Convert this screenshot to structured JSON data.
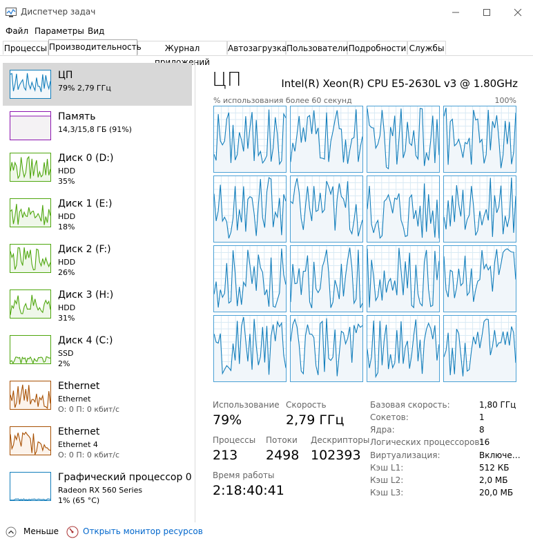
{
  "window": {
    "title": "Диспетчер задач"
  },
  "menu": [
    "Файл",
    "Параметры",
    "Вид"
  ],
  "tabs": [
    "Процессы",
    "Производительность",
    "Журнал приложений",
    "Автозагрузка",
    "Пользователи",
    "Подробности",
    "Службы"
  ],
  "active_tab": "Производительность",
  "sidebar": [
    {
      "name": "ЦП",
      "line2": "79%  2,79 ГГц",
      "line3": "",
      "color": "#117dbb",
      "fill": "#f1f6fa",
      "selected": true
    },
    {
      "name": "Память",
      "line2": "14,3/15,8 ГБ (91%)",
      "line3": "",
      "color": "#8b12ae",
      "fill": "#f4f2f4",
      "selected": false
    },
    {
      "name": "Диск 0 (D:)",
      "line2": "HDD",
      "line3": "35%",
      "color": "#4da60c",
      "fill": "#eff7e9",
      "selected": false
    },
    {
      "name": "Диск 1 (E:)",
      "line2": "HDD",
      "line3": "18%",
      "color": "#4da60c",
      "fill": "#eff7e9",
      "selected": false
    },
    {
      "name": "Диск 2 (F:)",
      "line2": "HDD",
      "line3": "26%",
      "color": "#4da60c",
      "fill": "#eff7e9",
      "selected": false
    },
    {
      "name": "Диск 3 (H:)",
      "line2": "HDD",
      "line3": "31%",
      "color": "#4da60c",
      "fill": "#eff7e9",
      "selected": false
    },
    {
      "name": "Диск 4 (C:)",
      "line2": "SSD",
      "line3": "2%",
      "color": "#4da60c",
      "fill": "#eff7e9",
      "selected": false
    },
    {
      "name": "Ethernet",
      "line2": "Ethernet",
      "line3": "О: 0 П: 0 кбит/с",
      "color": "#a74f01",
      "fill": "#fcf3eb",
      "selected": false
    },
    {
      "name": "Ethernet",
      "line2": "Ethernet 4",
      "line3": "О: 0 П: 0 кбит/с",
      "color": "#a74f01",
      "fill": "#fcf3eb",
      "selected": false
    },
    {
      "name": "Графический процессор 0",
      "line2": "Radeon RX 560 Series",
      "line3": "1% (65 °C)",
      "color": "#117dbb",
      "fill": "#f1f6fa",
      "selected": false
    }
  ],
  "main": {
    "title": "ЦП",
    "cpu_model": "Intel(R) Xeon(R) CPU E5-2630L v3 @ 1.80GHz",
    "graph_label": "% использования более 60 секунд",
    "graph_max": "100%",
    "stats": {
      "usage_label": "Использование",
      "usage_value": "79%",
      "speed_label": "Скорость",
      "speed_value": "2,79 ГГц",
      "processes_label": "Процессы",
      "processes_value": "213",
      "threads_label": "Потоки",
      "threads_value": "2498",
      "handles_label": "Дескрипторы",
      "handles_value": "102393",
      "uptime_label": "Время работы",
      "uptime_value": "2:18:40:41"
    },
    "details": [
      {
        "label": "Базовая скорость:",
        "value": "1,80 ГГц"
      },
      {
        "label": "Сокетов:",
        "value": "1"
      },
      {
        "label": "Ядра:",
        "value": "8"
      },
      {
        "label": "Логических процессоров:",
        "value": "16"
      },
      {
        "label": "Виртуализация:",
        "value": "Включе…"
      },
      {
        "label": "Кэш L1:",
        "value": "512 КБ"
      },
      {
        "label": "Кэш L2:",
        "value": "2,0 МБ"
      },
      {
        "label": "Кэш L3:",
        "value": "20,0 МБ"
      }
    ]
  },
  "footer": {
    "less_label": "Меньше",
    "monitor_link": "Открыть монитор ресурсов"
  },
  "colors": {
    "cpu_line": "#117dbb",
    "cpu_fill": "#f1f6fa",
    "grid_line": "#d9eaf4"
  }
}
